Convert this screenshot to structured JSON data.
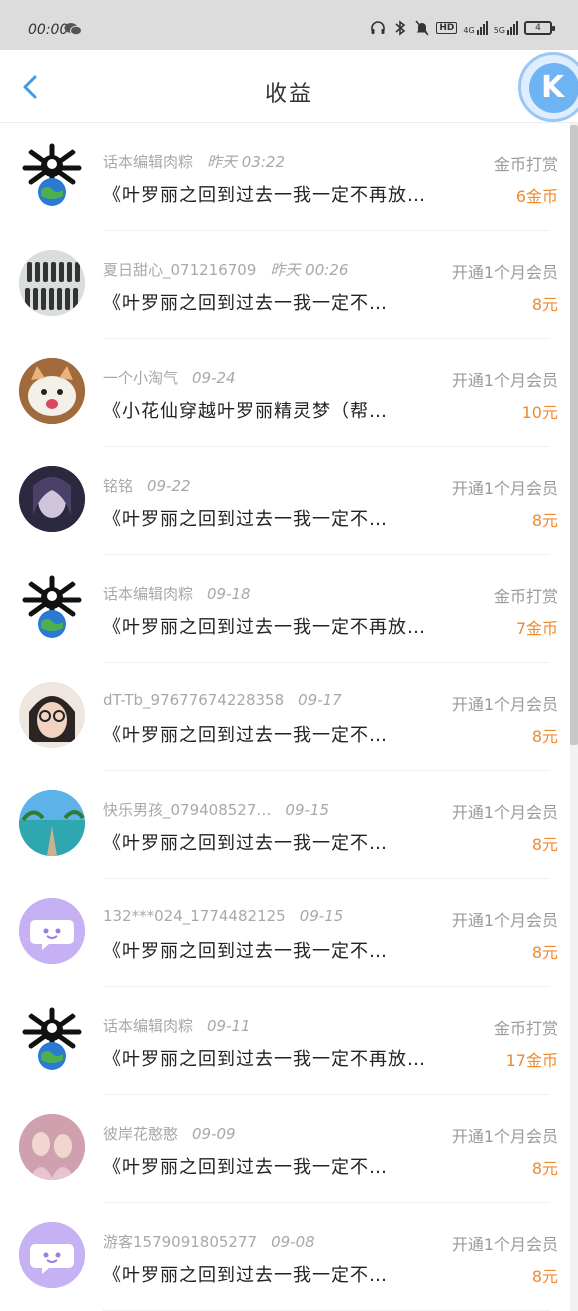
{
  "status_bar": {
    "time": "00:00",
    "icons": [
      "wechat-icon",
      "headphones-icon",
      "bluetooth-icon",
      "mute-icon",
      "hd-icon",
      "signal-4g-icon",
      "signal-5g-icon",
      "battery-icon"
    ],
    "hd_label": "HD",
    "net1_label": "4G",
    "net2_label": "5G",
    "battery_level": "4"
  },
  "header": {
    "title": "收益",
    "back_icon": "chevron-left-icon",
    "badge_letter": "K"
  },
  "colors": {
    "accent_blue": "#3d9be9",
    "amount_orange": "#f08a2f",
    "muted_text": "#a8a8a8"
  },
  "records": [
    {
      "user": "话本编辑肉粽",
      "date": "昨天 03:22",
      "type": "金币打赏",
      "content": "《叶罗丽之回到过去一我一定不再放…",
      "amount": "6金币",
      "avatar": "skull-globe"
    },
    {
      "user": "夏日甜心_071216709",
      "date": "昨天 00:26",
      "type": "开通1个月会员",
      "content": "《叶罗丽之回到过去一我一定不…",
      "amount": "8元",
      "avatar": "group-photo"
    },
    {
      "user": "一个小淘气",
      "date": "09-24",
      "type": "开通1个月会员",
      "content": "《小花仙穿越叶罗丽精灵梦（帮…",
      "amount": "10元",
      "avatar": "kitten"
    },
    {
      "user": "铭铭",
      "date": "09-22",
      "type": "开通1个月会员",
      "content": "《叶罗丽之回到过去一我一定不…",
      "amount": "8元",
      "avatar": "dark-portrait"
    },
    {
      "user": "话本编辑肉粽",
      "date": "09-18",
      "type": "金币打赏",
      "content": "《叶罗丽之回到过去一我一定不再放…",
      "amount": "7金币",
      "avatar": "skull-globe"
    },
    {
      "user": "dT-Tb_97677674228358",
      "date": "09-17",
      "type": "开通1个月会员",
      "content": "《叶罗丽之回到过去一我一定不…",
      "amount": "8元",
      "avatar": "glasses-girl"
    },
    {
      "user": "快乐男孩_079408527…",
      "date": "09-15",
      "type": "开通1个月会员",
      "content": "《叶罗丽之回到过去一我一定不…",
      "amount": "8元",
      "avatar": "beach"
    },
    {
      "user": "132***024_1774482125",
      "date": "09-15",
      "type": "开通1个月会员",
      "content": "《叶罗丽之回到过去一我一定不…",
      "amount": "8元",
      "avatar": "chat-bubble"
    },
    {
      "user": "话本编辑肉粽",
      "date": "09-11",
      "type": "金币打赏",
      "content": "《叶罗丽之回到过去一我一定不再放…",
      "amount": "17金币",
      "avatar": "skull-globe"
    },
    {
      "user": "彼岸花憨憨",
      "date": "09-09",
      "type": "开通1个月会员",
      "content": "《叶罗丽之回到过去一我一定不…",
      "amount": "8元",
      "avatar": "pink-costume"
    },
    {
      "user": "游客1579091805277",
      "date": "09-08",
      "type": "开通1个月会员",
      "content": "《叶罗丽之回到过去一我一定不…",
      "amount": "8元",
      "avatar": "chat-bubble"
    }
  ]
}
